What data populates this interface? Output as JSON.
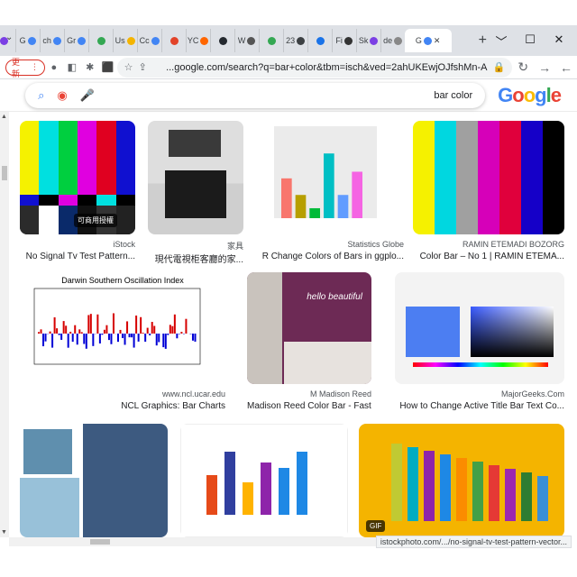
{
  "browser": {
    "window_controls": [
      "✕",
      "☐",
      "﹀"
    ],
    "tabs": [
      {
        "label": "G",
        "color": "#4285f4",
        "active": true
      },
      {
        "label": "de",
        "color": "#888888"
      },
      {
        "label": "Sk",
        "color": "#7b3fe4"
      },
      {
        "label": "Fi",
        "color": "#333333"
      },
      {
        "label": "",
        "color": "#1a73e8"
      },
      {
        "label": "23",
        "color": "#3c4043"
      },
      {
        "label": "",
        "color": "#34a853"
      },
      {
        "label": "W",
        "color": "#555555"
      },
      {
        "label": "",
        "color": "#24292f"
      },
      {
        "label": "YC",
        "color": "#ff6600"
      },
      {
        "label": "",
        "color": "#e24329"
      },
      {
        "label": "Cc",
        "color": "#4285f4"
      },
      {
        "label": "Us",
        "color": "#f4b400"
      },
      {
        "label": "",
        "color": "#34a853"
      },
      {
        "label": "Gr",
        "color": "#4285f4"
      },
      {
        "label": "ch",
        "color": "#4285f4"
      },
      {
        "label": "G",
        "color": "#4285f4"
      },
      {
        "label": "",
        "color": "#7b3fe4"
      }
    ],
    "new_tab": "+",
    "url": "google.com/search?q=bar+color&tbm=isch&ved=2ahUKEwjOJfshMn-A...",
    "update_label": "更新"
  },
  "search": {
    "query": "bar color",
    "logo_letters": [
      "G",
      "o",
      "o",
      "g",
      "l",
      "e"
    ]
  },
  "results": [
    {
      "source": "RAMIN ETEMADI BOZORG",
      "title": "Color Bar – No 1 | RAMIN ETEMA...",
      "kind": "tv_bars"
    },
    {
      "source": "Statistics Globe",
      "title": "R Change Colors of Bars in ggplo...",
      "kind": "ggplot"
    },
    {
      "source": "家具",
      "title": "現代電視柜客廳的家...",
      "kind": "cabinet"
    },
    {
      "source": "iStock",
      "title": "No Signal Tv Test Pattern...",
      "kind": "nosignal",
      "badge": "可商用授權"
    },
    {
      "source": "MajorGeeks.Com",
      "title": "How to Change Active Title Bar Text Co...",
      "kind": "colorpicker"
    },
    {
      "source": "M Madison Reed",
      "title": "Madison Reed Color Bar - Fast &...",
      "kind": "salon"
    },
    {
      "source": "www.ncl.ucar.edu",
      "title": "NCL Graphics: Bar Charts",
      "kind": "oscillation",
      "chart_title": "Darwin Southern Oscillation Index"
    },
    {
      "source": "",
      "title": "",
      "kind": "yellow_chart",
      "badge": "GIF"
    },
    {
      "source": "",
      "title": "",
      "kind": "code_chart"
    },
    {
      "source": "",
      "title": "",
      "kind": "tiles"
    }
  ],
  "status_url": "istockphoto.com/.../no-signal-tv-test-pattern-vector..."
}
